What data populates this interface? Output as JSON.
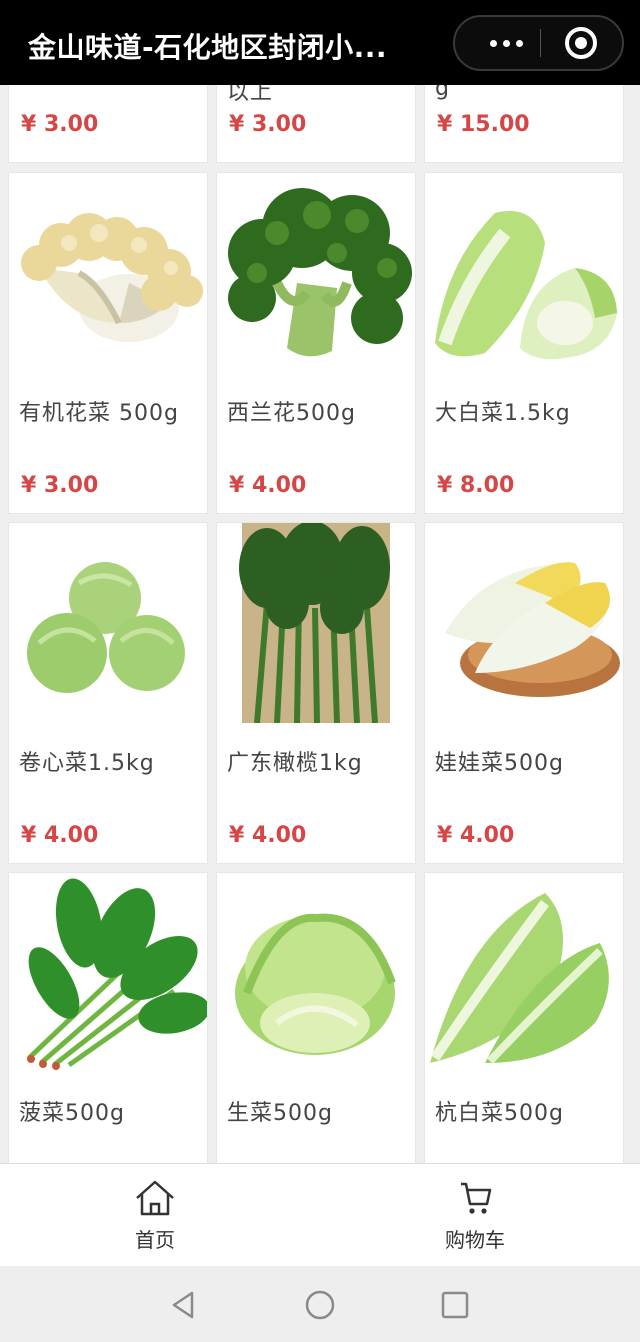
{
  "window": {
    "title": "金山味道-石化地区封闭小..."
  },
  "products": [
    {
      "name": "",
      "name_tail": "",
      "price": "¥ 3.00"
    },
    {
      "name": "",
      "name_tail": "以上",
      "price": "¥ 3.00"
    },
    {
      "name": "",
      "name_tail": "g",
      "price": "¥ 15.00"
    },
    {
      "name": "有机花菜 500g",
      "price": "¥ 3.00",
      "image": "cauliflower"
    },
    {
      "name": "西兰花500g",
      "price": "¥ 4.00",
      "image": "broccoli"
    },
    {
      "name": "大白菜1.5kg",
      "price": "¥ 8.00",
      "image": "napa-cabbage"
    },
    {
      "name": "卷心菜1.5kg",
      "price": "¥ 4.00",
      "image": "cabbage"
    },
    {
      "name": "广东橄榄1kg",
      "price": "¥ 4.00",
      "image": "leafy-greens-bunch"
    },
    {
      "name": "娃娃菜500g",
      "price": "¥ 4.00",
      "image": "baby-cabbage"
    },
    {
      "name": "菠菜500g",
      "price": "",
      "image": "spinach"
    },
    {
      "name": "生菜500g",
      "price": "",
      "image": "lettuce"
    },
    {
      "name": "杭白菜500g",
      "price": "",
      "image": "bok-choy"
    }
  ],
  "tabbar": {
    "home": {
      "label": "首页",
      "icon": "home-icon"
    },
    "cart": {
      "label": "购物车",
      "icon": "cart-icon"
    }
  },
  "colors": {
    "price": "#d64646",
    "header": "#000000"
  }
}
